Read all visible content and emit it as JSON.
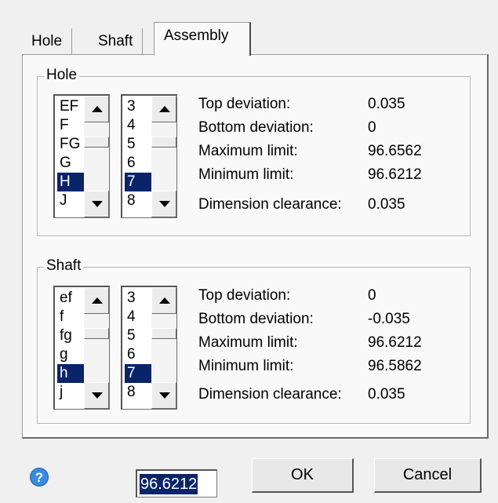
{
  "tabs": [
    {
      "label": "Hole",
      "active": false
    },
    {
      "label": "Shaft",
      "active": false
    },
    {
      "label": "Assembly",
      "active": true
    }
  ],
  "hole": {
    "title": "Hole",
    "letters": {
      "items": [
        "EF",
        "F",
        "FG",
        "G",
        "H",
        "J"
      ],
      "selected": "H"
    },
    "grades": {
      "items": [
        "3",
        "4",
        "5",
        "6",
        "7",
        "8"
      ],
      "selected": "7"
    },
    "top_deviation_label": "Top deviation:",
    "top_deviation": "0.035",
    "bottom_deviation_label": "Bottom deviation:",
    "bottom_deviation": "0",
    "max_limit_label": "Maximum limit:",
    "max_limit": "96.6562",
    "min_limit_label": "Minimum limit:",
    "min_limit": "96.6212",
    "clearance_label": "Dimension clearance:",
    "clearance": "0.035"
  },
  "shaft": {
    "title": "Shaft",
    "letters": {
      "items": [
        "ef",
        "f",
        "fg",
        "g",
        "h",
        "j"
      ],
      "selected": "h"
    },
    "grades": {
      "items": [
        "3",
        "4",
        "5",
        "6",
        "7",
        "8"
      ],
      "selected": "7"
    },
    "top_deviation_label": "Top deviation:",
    "top_deviation": "0",
    "bottom_deviation_label": "Bottom deviation:",
    "bottom_deviation": "-0.035",
    "max_limit_label": "Maximum limit:",
    "max_limit": "96.6212",
    "min_limit_label": "Minimum limit:",
    "min_limit": "96.5862",
    "clearance_label": "Dimension clearance:",
    "clearance": "0.035"
  },
  "footer": {
    "help_icon": "?",
    "value": "96.6212",
    "ok_label": "OK",
    "cancel_label": "Cancel"
  },
  "colors": {
    "selection": "#0a246a",
    "help_icon": "#3a8be0"
  }
}
